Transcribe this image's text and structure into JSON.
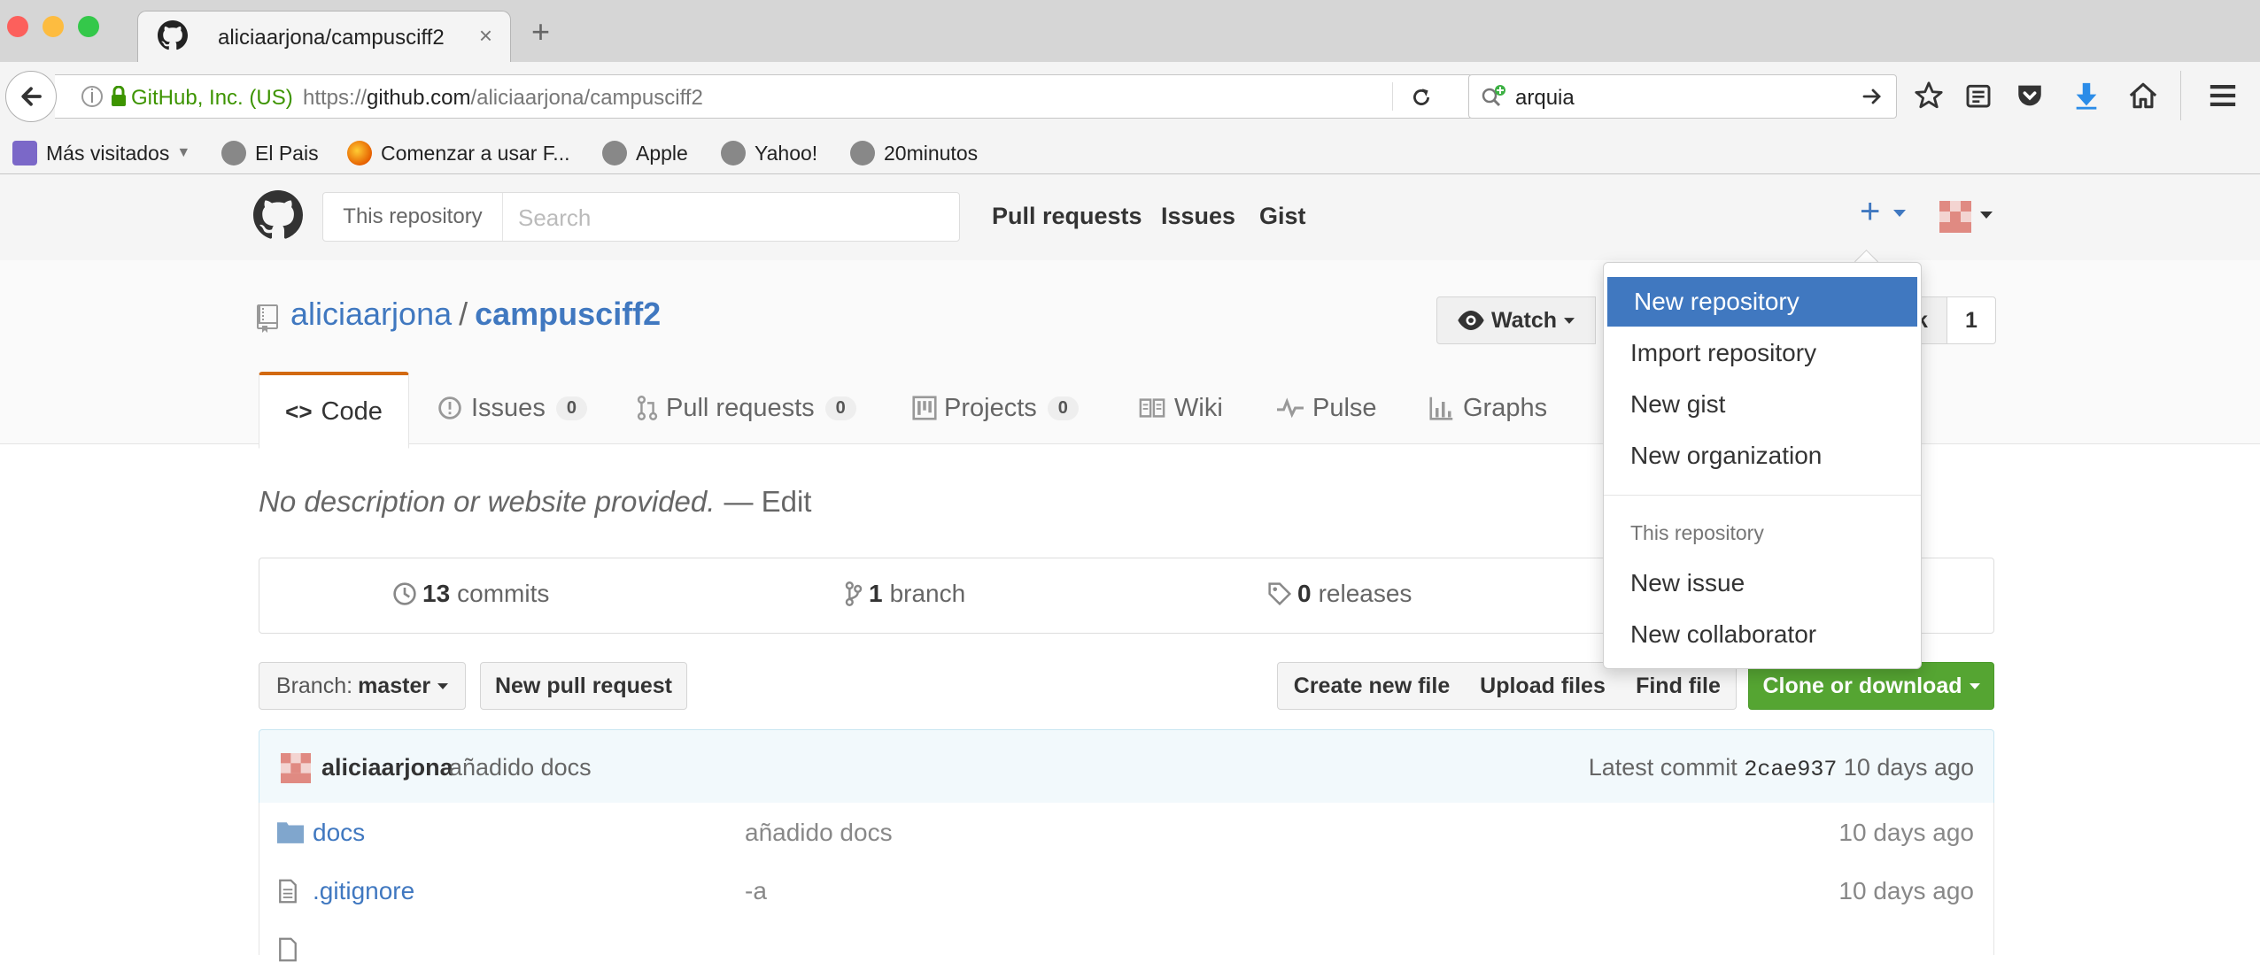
{
  "browser": {
    "tab_title": "aliciaarjona/campusciff2",
    "site_identity": "GitHub, Inc. (US)",
    "url_prefix": "https://",
    "url_host": "github.com",
    "url_path": "/aliciaarjona/campusciff2",
    "search_value": "arquia",
    "bookmarks": [
      "Más visitados",
      "El Pais",
      "Comenzar a usar F...",
      "Apple",
      "Yahoo!",
      "20minutos"
    ]
  },
  "github": {
    "search_scope": "This repository",
    "search_placeholder": "Search",
    "nav": [
      "Pull requests",
      "Issues",
      "Gist"
    ]
  },
  "repo": {
    "owner": "aliciaarjona",
    "separator": "/",
    "name": "campusciff2",
    "watch_label": "Watch",
    "fork_tail": "k",
    "fork_count": "1",
    "tabs": [
      {
        "label": "Code"
      },
      {
        "label": "Issues",
        "count": "0"
      },
      {
        "label": "Pull requests",
        "count": "0"
      },
      {
        "label": "Projects",
        "count": "0"
      },
      {
        "label": "Wiki"
      },
      {
        "label": "Pulse"
      },
      {
        "label": "Graphs"
      }
    ],
    "description": "No description or website provided.",
    "edit_label": "— Edit",
    "stats": {
      "commits_num": "13",
      "commits_label": "commits",
      "branch_num": "1",
      "branch_label": "branch",
      "releases_num": "0",
      "releases_label": "releases"
    },
    "branch_prefix": "Branch:",
    "branch_name": "master",
    "buttons": {
      "new_pr": "New pull request",
      "create_file": "Create new file",
      "upload_files": "Upload files",
      "find_file": "Find file",
      "clone": "Clone or download"
    },
    "latest_commit": {
      "author": "aliciaarjona",
      "message": "añadido docs",
      "prefix": "Latest commit",
      "sha": "2cae937",
      "age": "10 days ago"
    },
    "files": [
      {
        "name": "docs",
        "message": "añadido docs",
        "age": "10 days ago",
        "type": "folder"
      },
      {
        "name": ".gitignore",
        "message": "-a",
        "age": "10 days ago",
        "type": "file"
      }
    ]
  },
  "dropdown": {
    "items": [
      "New repository",
      "Import repository",
      "New gist",
      "New organization"
    ],
    "section_header": "This repository",
    "section_items": [
      "New issue",
      "New collaborator"
    ]
  },
  "colors": {
    "link": "#4078c0",
    "clone_green": "#55a532",
    "tab_accent": "#d26911",
    "dropdown_active": "#4078c0"
  }
}
